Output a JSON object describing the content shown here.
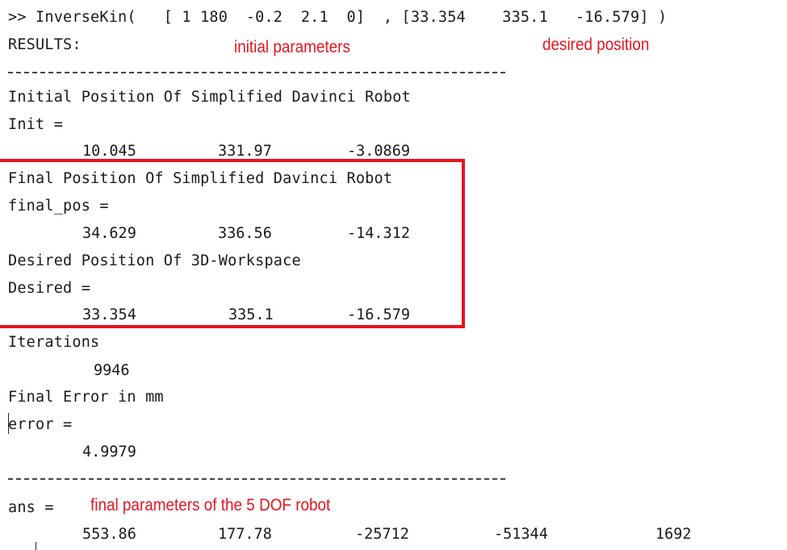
{
  "console": {
    "command": ">> InverseKin(   [ 1 180  -0.2  2.1  0]  , [33.354    335.1   -16.579] )",
    "results_label": "RESULTS:",
    "annotations": {
      "initial_parameters": "initial parameters",
      "desired_position": "desired position",
      "final_parameters": "final parameters of the 5 DOF robot"
    },
    "init_heading": "Initial Position Of Simplified Davinci Robot",
    "init_var": "Init =",
    "init_values": [
      "10.045",
      "331.97",
      "-3.0869"
    ],
    "final_heading": "Final Position Of Simplified Davinci Robot",
    "final_var": "final_pos =",
    "final_values": [
      "34.629",
      "336.56",
      "-14.312"
    ],
    "desired_heading": "Desired Position Of 3D-Workspace",
    "desired_var": "Desired =",
    "desired_values": [
      "33.354",
      "335.1",
      "-16.579"
    ],
    "iterations_heading": "Iterations",
    "iterations_value": "9946",
    "error_heading": "Final Error in mm",
    "error_var": "error =",
    "error_value": "4.9979",
    "ans_var": "ans =",
    "ans_values": [
      "553.86",
      "177.78",
      "-25712",
      "-51344",
      "1692"
    ],
    "highlight_color": "#e8141d"
  }
}
